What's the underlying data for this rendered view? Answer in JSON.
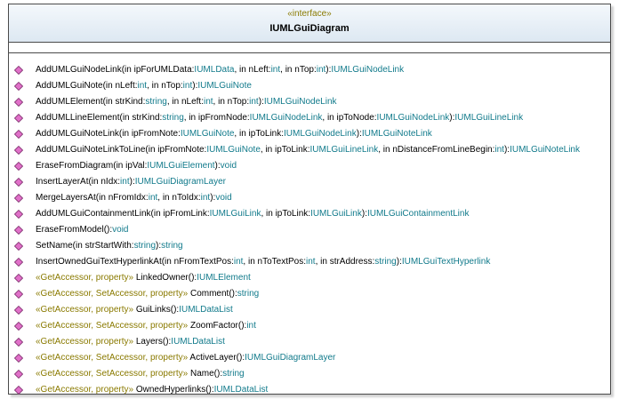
{
  "class_box": {
    "stereotype": "«interface»",
    "name": "IUMLGuiDiagram"
  },
  "colors": {
    "icon_fill": "#e070c8",
    "icon_stroke": "#7a2a6a",
    "type_color": "#117a8b",
    "stereotype_color": "#8a7a00",
    "border": "#4a4a4a"
  },
  "icon": "method-diamond-icon",
  "operations": [
    {
      "name": "AddUMLGuiNodeLink",
      "segments": [
        {
          "t": "AddUMLGuiNodeLink(in ipForUMLData:",
          "c": "blk"
        },
        {
          "t": "IUMLData",
          "c": "teal"
        },
        {
          "t": ", in nLeft:",
          "c": "blk"
        },
        {
          "t": "int",
          "c": "teal"
        },
        {
          "t": ", in nTop:",
          "c": "blk"
        },
        {
          "t": "int",
          "c": "teal"
        },
        {
          "t": "):",
          "c": "blk"
        },
        {
          "t": "IUMLGuiNodeLink",
          "c": "teal"
        }
      ]
    },
    {
      "name": "AddUMLGuiNote",
      "segments": [
        {
          "t": "AddUMLGuiNote(in nLeft:",
          "c": "blk"
        },
        {
          "t": "int",
          "c": "teal"
        },
        {
          "t": ", in nTop:",
          "c": "blk"
        },
        {
          "t": "int",
          "c": "teal"
        },
        {
          "t": "):",
          "c": "blk"
        },
        {
          "t": "IUMLGuiNote",
          "c": "teal"
        }
      ]
    },
    {
      "name": "AddUMLElement",
      "segments": [
        {
          "t": "AddUMLElement(in strKind:",
          "c": "blk"
        },
        {
          "t": "string",
          "c": "teal"
        },
        {
          "t": ", in nLeft:",
          "c": "blk"
        },
        {
          "t": "int",
          "c": "teal"
        },
        {
          "t": ", in nTop:",
          "c": "blk"
        },
        {
          "t": "int",
          "c": "teal"
        },
        {
          "t": "):",
          "c": "blk"
        },
        {
          "t": "IUMLGuiNodeLink",
          "c": "teal"
        }
      ]
    },
    {
      "name": "AddUMLLineElement",
      "segments": [
        {
          "t": "AddUMLLineElement(in strKind:",
          "c": "blk"
        },
        {
          "t": "string",
          "c": "teal"
        },
        {
          "t": ", in ipFromNode:",
          "c": "blk"
        },
        {
          "t": "IUMLGuiNodeLink",
          "c": "teal"
        },
        {
          "t": ", in ipToNode:",
          "c": "blk"
        },
        {
          "t": "IUMLGuiNodeLink",
          "c": "teal"
        },
        {
          "t": "):",
          "c": "blk"
        },
        {
          "t": "IUMLGuiLineLink",
          "c": "teal"
        }
      ]
    },
    {
      "name": "AddUMLGuiNoteLink",
      "segments": [
        {
          "t": "AddUMLGuiNoteLink(in ipFromNote:",
          "c": "blk"
        },
        {
          "t": "IUMLGuiNote",
          "c": "teal"
        },
        {
          "t": ", in ipToLink:",
          "c": "blk"
        },
        {
          "t": "IUMLGuiNodeLink",
          "c": "teal"
        },
        {
          "t": "):",
          "c": "blk"
        },
        {
          "t": "IUMLGuiNoteLink",
          "c": "teal"
        }
      ]
    },
    {
      "name": "AddUMLGuiNoteLinkToLine",
      "segments": [
        {
          "t": "AddUMLGuiNoteLinkToLine(in ipFromNote:",
          "c": "blk"
        },
        {
          "t": "IUMLGuiNote",
          "c": "teal"
        },
        {
          "t": ", in ipToLink:",
          "c": "blk"
        },
        {
          "t": "IUMLGuiLineLink",
          "c": "teal"
        },
        {
          "t": ", in nDistanceFromLineBegin:",
          "c": "blk"
        },
        {
          "t": "int",
          "c": "teal"
        },
        {
          "t": "):",
          "c": "blk"
        },
        {
          "t": "IUMLGuiNoteLink",
          "c": "teal"
        }
      ]
    },
    {
      "name": "EraseFromDiagram",
      "segments": [
        {
          "t": "EraseFromDiagram(in ipVal:",
          "c": "blk"
        },
        {
          "t": "IUMLGuiElement",
          "c": "teal"
        },
        {
          "t": "):",
          "c": "blk"
        },
        {
          "t": "void",
          "c": "teal"
        }
      ]
    },
    {
      "name": "InsertLayerAt",
      "segments": [
        {
          "t": "InsertLayerAt(in nIdx:",
          "c": "blk"
        },
        {
          "t": "int",
          "c": "teal"
        },
        {
          "t": "):",
          "c": "blk"
        },
        {
          "t": "IUMLGuiDiagramLayer",
          "c": "teal"
        }
      ]
    },
    {
      "name": "MergeLayersAt",
      "segments": [
        {
          "t": "MergeLayersAt(in nFromIdx:",
          "c": "blk"
        },
        {
          "t": "int",
          "c": "teal"
        },
        {
          "t": ", in nToIdx:",
          "c": "blk"
        },
        {
          "t": "int",
          "c": "teal"
        },
        {
          "t": "):",
          "c": "blk"
        },
        {
          "t": "void",
          "c": "teal"
        }
      ]
    },
    {
      "name": "AddUMLGuiContainmentLink",
      "segments": [
        {
          "t": "AddUMLGuiContainmentLink(in ipFromLink:",
          "c": "blk"
        },
        {
          "t": "IUMLGuiLink",
          "c": "teal"
        },
        {
          "t": ", in ipToLink:",
          "c": "blk"
        },
        {
          "t": "IUMLGuiLink",
          "c": "teal"
        },
        {
          "t": "):",
          "c": "blk"
        },
        {
          "t": "IUMLGuiContainmentLink",
          "c": "teal"
        }
      ]
    },
    {
      "name": "EraseFromModel",
      "segments": [
        {
          "t": "EraseFromModel():",
          "c": "blk"
        },
        {
          "t": "void",
          "c": "teal"
        }
      ]
    },
    {
      "name": "SetName",
      "segments": [
        {
          "t": "SetName(in strStartWith:",
          "c": "blk"
        },
        {
          "t": "string",
          "c": "teal"
        },
        {
          "t": "):",
          "c": "blk"
        },
        {
          "t": "string",
          "c": "teal"
        }
      ]
    },
    {
      "name": "InsertOwnedGuiTextHyperlinkAt",
      "segments": [
        {
          "t": "InsertOwnedGuiTextHyperlinkAt(in nFromTextPos:",
          "c": "blk"
        },
        {
          "t": "int",
          "c": "teal"
        },
        {
          "t": ", in nToTextPos:",
          "c": "blk"
        },
        {
          "t": "int",
          "c": "teal"
        },
        {
          "t": ", in strAddress:",
          "c": "blk"
        },
        {
          "t": "string",
          "c": "teal"
        },
        {
          "t": "):",
          "c": "blk"
        },
        {
          "t": "IUMLGuiTextHyperlink",
          "c": "teal"
        }
      ]
    },
    {
      "name": "LinkedOwner",
      "segments": [
        {
          "t": "«GetAccessor, property» ",
          "c": "olive"
        },
        {
          "t": "LinkedOwner():",
          "c": "blk"
        },
        {
          "t": "IUMLElement",
          "c": "teal"
        }
      ]
    },
    {
      "name": "Comment",
      "segments": [
        {
          "t": "«GetAccessor, SetAccessor, property» ",
          "c": "olive"
        },
        {
          "t": "Comment():",
          "c": "blk"
        },
        {
          "t": "string",
          "c": "teal"
        }
      ]
    },
    {
      "name": "GuiLinks",
      "segments": [
        {
          "t": "«GetAccessor, property» ",
          "c": "olive"
        },
        {
          "t": "GuiLinks():",
          "c": "blk"
        },
        {
          "t": "IUMLDataList",
          "c": "teal"
        }
      ]
    },
    {
      "name": "ZoomFactor",
      "segments": [
        {
          "t": "«GetAccessor, SetAccessor, property» ",
          "c": "olive"
        },
        {
          "t": "ZoomFactor():",
          "c": "blk"
        },
        {
          "t": "int",
          "c": "teal"
        }
      ]
    },
    {
      "name": "Layers",
      "segments": [
        {
          "t": "«GetAccessor, property» ",
          "c": "olive"
        },
        {
          "t": "Layers():",
          "c": "blk"
        },
        {
          "t": "IUMLDataList",
          "c": "teal"
        }
      ]
    },
    {
      "name": "ActiveLayer",
      "segments": [
        {
          "t": "«GetAccessor, SetAccessor, property» ",
          "c": "olive"
        },
        {
          "t": "ActiveLayer():",
          "c": "blk"
        },
        {
          "t": "IUMLGuiDiagramLayer",
          "c": "teal"
        }
      ]
    },
    {
      "name": "Name",
      "segments": [
        {
          "t": "«GetAccessor, SetAccessor, property» ",
          "c": "olive"
        },
        {
          "t": "Name():",
          "c": "blk"
        },
        {
          "t": "string",
          "c": "teal"
        }
      ]
    },
    {
      "name": "OwnedHyperlinks",
      "segments": [
        {
          "t": "«GetAccessor, property» ",
          "c": "olive"
        },
        {
          "t": "OwnedHyperlinks():",
          "c": "blk"
        },
        {
          "t": "IUMLDataList",
          "c": "teal"
        }
      ]
    }
  ]
}
